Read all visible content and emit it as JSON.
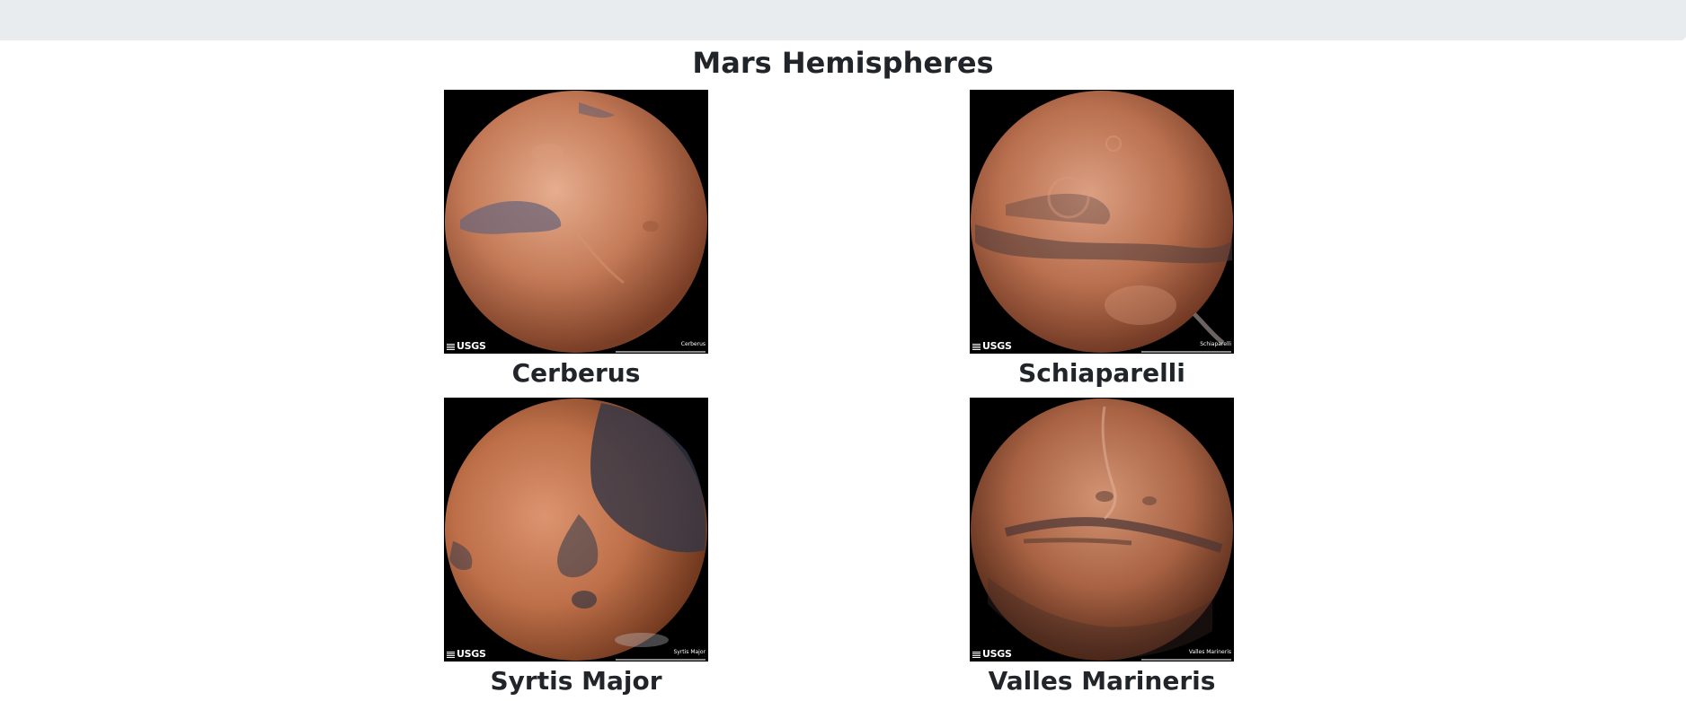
{
  "page": {
    "title": "Mars Hemispheres"
  },
  "hemispheres": [
    {
      "name": "Cerberus",
      "image": {
        "credit": "USGS",
        "caption": "Cerberus"
      },
      "colors": {
        "base": "#c47a57",
        "light": "#e0a586",
        "dark": "#5e5d71"
      }
    },
    {
      "name": "Schiaparelli",
      "image": {
        "credit": "USGS",
        "caption": "Schiaparelli"
      },
      "colors": {
        "base": "#b9704f",
        "light": "#d99a7c",
        "dark": "#4e3c3c"
      }
    },
    {
      "name": "Syrtis Major",
      "image": {
        "credit": "USGS",
        "caption": "Syrtis Major"
      },
      "colors": {
        "base": "#bd6f48",
        "light": "#dc9470",
        "dark": "#323646"
      }
    },
    {
      "name": "Valles Marineris",
      "image": {
        "credit": "USGS",
        "caption": "Valles Marineris"
      },
      "colors": {
        "base": "#a96344",
        "light": "#d29474",
        "dark": "#4a3434"
      }
    }
  ]
}
